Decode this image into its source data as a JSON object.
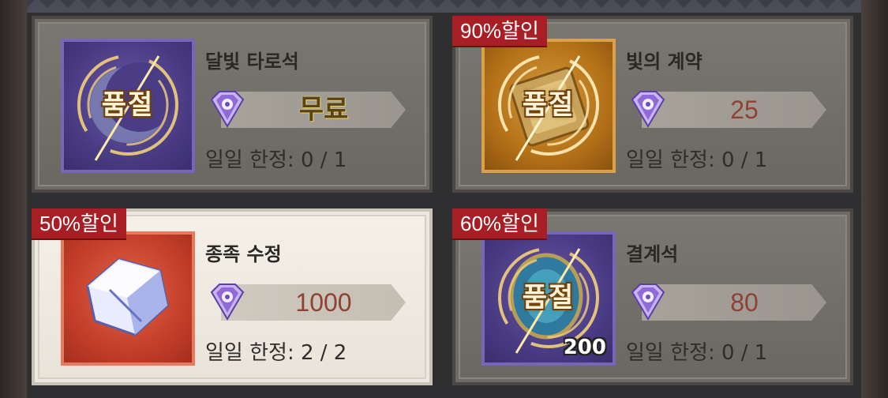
{
  "items": [
    {
      "name": "달빛 타로석",
      "price": "무료",
      "limit_label": "일일 한정: 0 / 1",
      "sold_out": "품절",
      "discount": "",
      "icon": "moon-tarot-icon"
    },
    {
      "name": "빛의 계약",
      "price": "25",
      "limit_label": "일일 한정: 0 / 1",
      "sold_out": "품절",
      "discount": "90%할인",
      "icon": "light-contract-icon"
    },
    {
      "name": "종족 수정",
      "price": "1000",
      "limit_label": "일일 한정: 2 / 2",
      "sold_out": "",
      "discount": "50%할인",
      "icon": "race-crystal-icon"
    },
    {
      "name": "결계석",
      "price": "80",
      "limit_label": "일일 한정: 0 / 1",
      "sold_out": "품절",
      "discount": "60%할인",
      "quantity": "200",
      "icon": "barrier-stone-icon"
    }
  ],
  "currency_icon": "diamond-gem-icon",
  "colors": {
    "discount_badge": "#a81e25",
    "price_text": "#8f4233",
    "card_bg": "#6e6b66",
    "selected_card_bg": "#ece8df"
  }
}
